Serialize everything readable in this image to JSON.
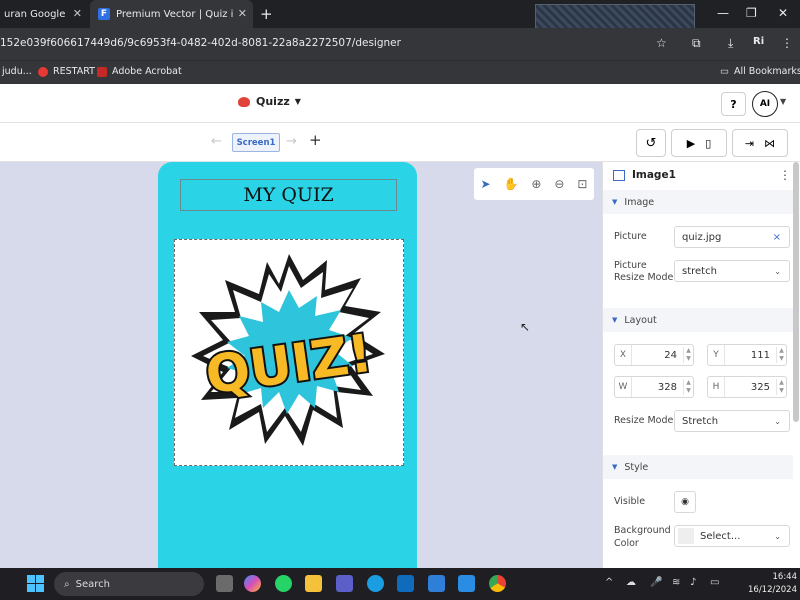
{
  "browser": {
    "tabs": [
      {
        "title": "uran Google"
      },
      {
        "title": "Premium Vector | Quiz in comic"
      }
    ],
    "url": "152e039f606617449d6/9c6953f4-0482-402d-8081-22a8a2272507/designer",
    "bookmarks": [
      {
        "label": "judu..."
      },
      {
        "label": "RESTART"
      },
      {
        "label": "Adobe Acrobat"
      }
    ],
    "all_bookmarks": "All Bookmarks",
    "icons": [
      "close-icon",
      "plus-icon",
      "minimize-icon",
      "maximize-icon",
      "star-icon",
      "extensions-icon",
      "download-icon",
      "profile-icon",
      "menu-icon",
      "folder-icon"
    ]
  },
  "app": {
    "project_name": "Quizz",
    "help_label": "?",
    "avatar_label": "AI",
    "screen_name": "Screen1",
    "accent_color": "#3a6ac4",
    "phone_color": "#2ad4e6",
    "canvas_color": "#d6daea"
  },
  "canvas": {
    "title_label": "MY QUIZ",
    "image_text": "QUIZ!"
  },
  "panel": {
    "component_name": "Image1",
    "sections": {
      "image": "Image",
      "layout": "Layout",
      "style": "Style"
    },
    "picture_label": "Picture",
    "picture_value": "quiz.jpg",
    "picture_clear": "×",
    "resize_mode_label_1": "Picture",
    "resize_mode_label_2": "Resize Mode",
    "picture_resize_value": "stretch",
    "x_label": "X",
    "x_value": "24",
    "y_label": "Y",
    "y_value": "111",
    "w_label": "W",
    "w_value": "328",
    "h_label": "H",
    "h_value": "325",
    "layout_resize_label": "Resize Mode",
    "layout_resize_value": "Stretch",
    "visible_label": "Visible",
    "bg_label_1": "Background",
    "bg_label_2": "Color",
    "bg_value": "Select..."
  },
  "taskbar": {
    "search_label": "Search",
    "time": "16:44",
    "date": "16/12/2024"
  }
}
